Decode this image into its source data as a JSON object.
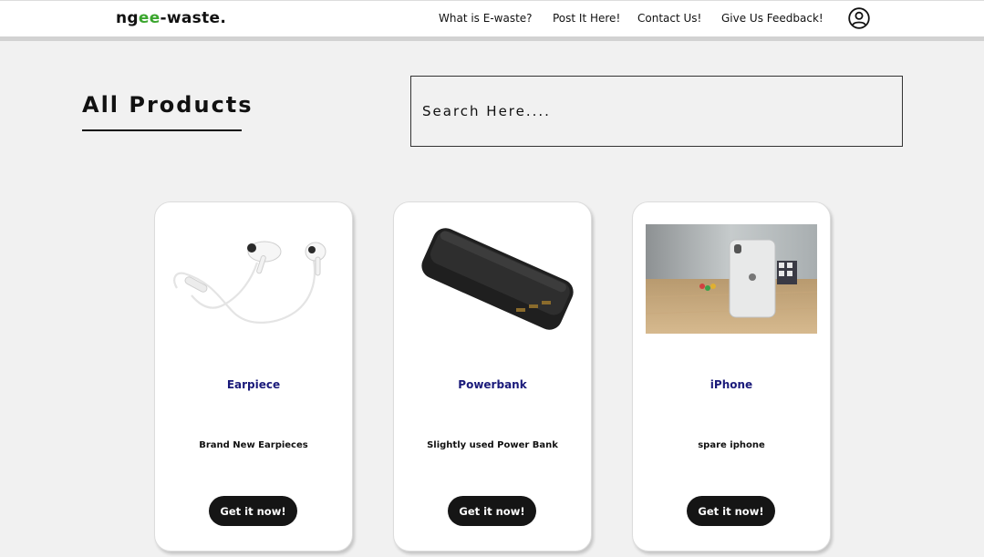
{
  "navbar": {
    "logo_prefix": "ng",
    "logo_highlight": "ee",
    "logo_suffix": "-waste.",
    "links": [
      {
        "label": "What is E-waste?"
      },
      {
        "label": "Post It Here!"
      },
      {
        "label": "Contact Us!"
      },
      {
        "label": "Give Us Feedback!"
      }
    ],
    "profile_icon": "user-circle-icon"
  },
  "main": {
    "title": "All Products",
    "search": {
      "placeholder": "Search Here....",
      "value": ""
    }
  },
  "products": [
    {
      "name": "Earpiece",
      "description": "Brand New Earpieces",
      "button_label": "Get it now!",
      "image": "earphones-image"
    },
    {
      "name": "Powerbank",
      "description": "Slightly used Power Bank",
      "button_label": "Get it now!",
      "image": "powerbank-image"
    },
    {
      "name": "iPhone",
      "description": "spare iphone",
      "button_label": "Get it now!",
      "image": "iphone-photo"
    }
  ],
  "colors": {
    "background": "#f1f1f1",
    "logo_accent": "#3ba62e",
    "product_name": "#1a1a7a",
    "button": "#151515"
  }
}
